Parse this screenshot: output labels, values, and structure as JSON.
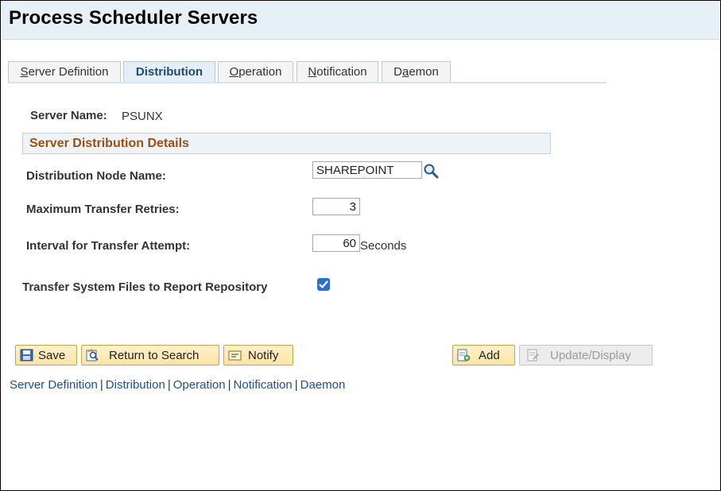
{
  "page": {
    "title": "Process Scheduler Servers"
  },
  "tabs": [
    {
      "label": "Server Definition",
      "access_key": "S",
      "rest": "erver Definition",
      "active": false
    },
    {
      "label": "Distribution",
      "access_key": "",
      "rest": "Distribution",
      "active": true
    },
    {
      "label": "Operation",
      "access_key": "O",
      "rest": "peration",
      "active": false
    },
    {
      "label": "Notification",
      "access_key": "N",
      "rest": "otification",
      "active": false
    },
    {
      "label": "Daemon",
      "pre": "D",
      "access_key": "a",
      "rest": "emon",
      "active": false
    }
  ],
  "form": {
    "server_name_label": "Server Name:",
    "server_name_value": "PSUNX",
    "section_title": "Server Distribution Details",
    "distribution_node_label": "Distribution Node Name:",
    "distribution_node_value": "SHAREPOINT",
    "max_retries_label": "Maximum Transfer Retries:",
    "max_retries_value": "3",
    "interval_label": "Interval for Transfer Attempt:",
    "interval_value": "60",
    "interval_unit": "Seconds",
    "transfer_files_label": "Transfer System Files to Report Repository",
    "transfer_files_checked": true
  },
  "buttons": {
    "save": "Save",
    "return_to_search": "Return to Search",
    "notify": "Notify",
    "add": "Add",
    "update_display": "Update/Display"
  },
  "bottom_links": {
    "server_definition": "Server Definition",
    "distribution": "Distribution",
    "operation": "Operation",
    "notification": "Notification",
    "daemon": "Daemon",
    "separator": "|"
  },
  "icons": {
    "lookup": "magnifier-icon",
    "save": "floppy-disk-icon",
    "return_to_search": "search-return-icon",
    "notify": "notify-message-icon",
    "add": "add-document-icon",
    "update_display": "update-display-icon",
    "checkbox": "checkmark-icon"
  },
  "colors": {
    "title_band": "#e6f0f7",
    "section_title": "#9a4f14",
    "link": "#1f4f8a",
    "checkbox": "#2c6fd0",
    "button_bg": "#fde3a6"
  }
}
